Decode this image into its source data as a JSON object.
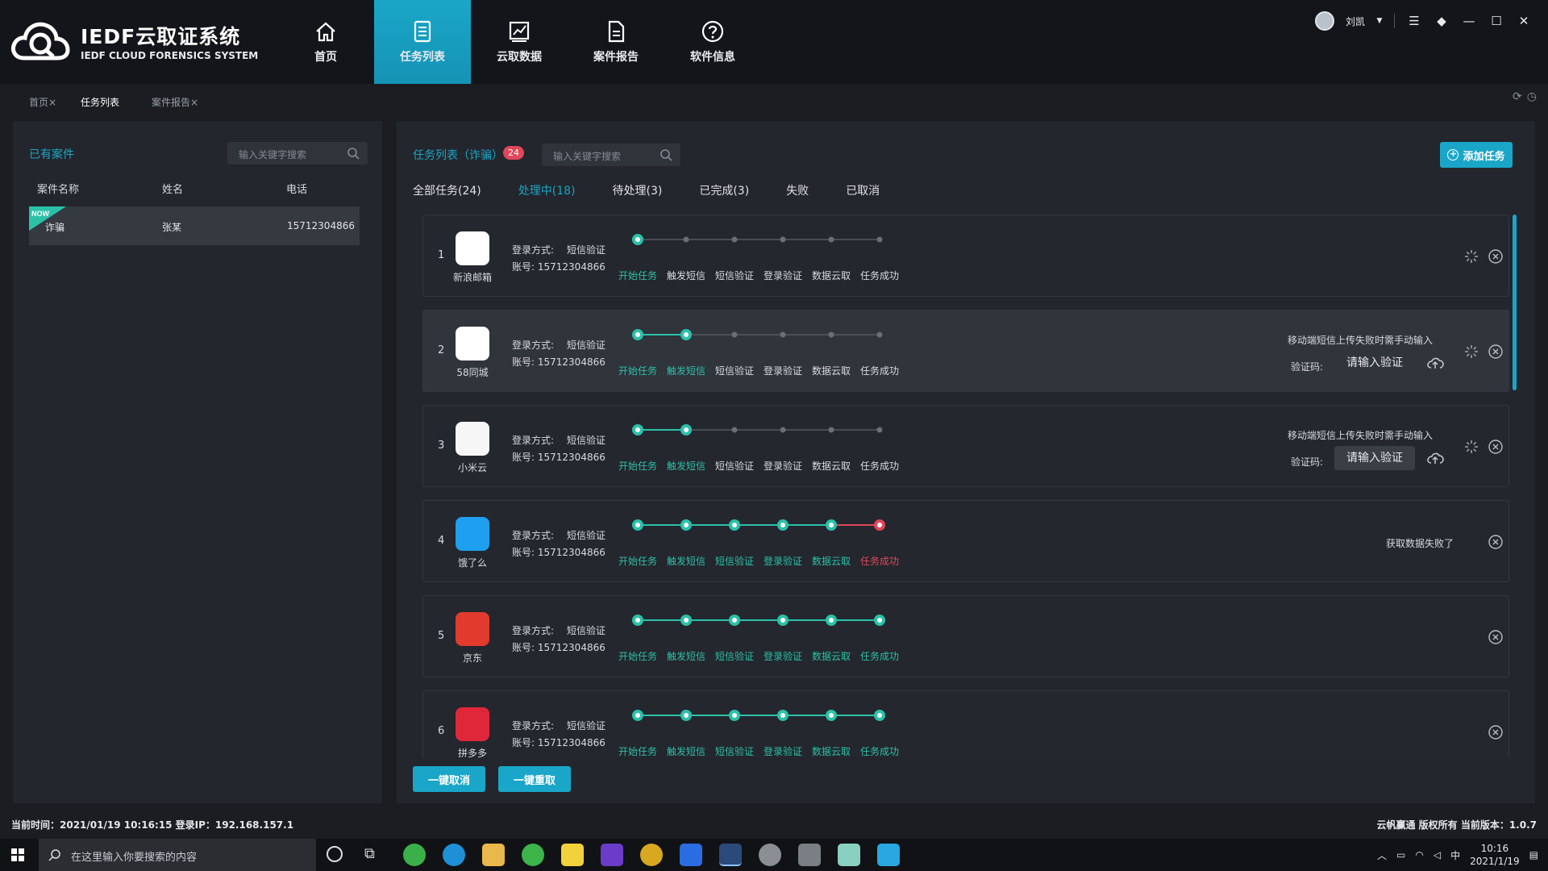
{
  "app": {
    "title": "IEDF云取证系统",
    "subtitle": "IEDF CLOUD FORENSICS SYSTEM"
  },
  "nav": {
    "items": [
      {
        "label": "首页",
        "icon": "home-icon"
      },
      {
        "label": "任务列表",
        "icon": "list-icon",
        "active": true
      },
      {
        "label": "云取数据",
        "icon": "chart-icon"
      },
      {
        "label": "案件报告",
        "icon": "document-icon"
      },
      {
        "label": "软件信息",
        "icon": "help-icon"
      }
    ]
  },
  "user": {
    "name": "刘凯"
  },
  "page_tabs": [
    {
      "label": "首页×"
    },
    {
      "label": "任务列表",
      "active": true
    },
    {
      "label": "案件报告×"
    }
  ],
  "cases": {
    "title": "已有案件",
    "search_placeholder": "输入关键字搜索",
    "columns": [
      "案件名称",
      "姓名",
      "电话"
    ],
    "rows": [
      {
        "badge": "NOW",
        "name": "诈骗",
        "person": "张某",
        "phone": "15712304866"
      }
    ]
  },
  "tasks": {
    "title": "任务列表（诈骗）",
    "count": "24",
    "search_placeholder": "输入关键字搜索",
    "add_label": "添加任务",
    "filters": [
      "全部任务(24)",
      "处理中(18)",
      "待处理(3)",
      "已完成(3)",
      "失败",
      "已取消"
    ],
    "active_filter": 1,
    "step_labels": [
      "开始任务",
      "触发短信",
      "短信验证",
      "登录验证",
      "数据云取",
      "任务成功"
    ],
    "login_label": "登录方式:",
    "login_value": "短信验证",
    "account_label": "账号:",
    "verify_label": "验证码:",
    "verify_placeholder": "请输入验证",
    "manual_note": "移动端短信上传失败时需手动输入",
    "items": [
      {
        "num": "1",
        "app": "新浪邮箱",
        "account": "15712304866",
        "progress": 1,
        "failed": false,
        "manual": false,
        "status": "",
        "color": "#ffffff"
      },
      {
        "num": "2",
        "app": "58同城",
        "account": "15712304866",
        "progress": 2,
        "failed": false,
        "manual": true,
        "status": "",
        "color": "#ffffff"
      },
      {
        "num": "3",
        "app": "小米云",
        "account": "15712304866",
        "progress": 2,
        "failed": false,
        "manual": true,
        "status": "",
        "color": "#f6f6f6"
      },
      {
        "num": "4",
        "app": "饿了么",
        "account": "15712304866",
        "progress": 6,
        "failed": true,
        "manual": false,
        "status": "获取数据失败了",
        "color": "#1e9ff0"
      },
      {
        "num": "5",
        "app": "京东",
        "account": "15712304866",
        "progress": 6,
        "failed": false,
        "manual": false,
        "status": "",
        "color": "#e33a2e"
      },
      {
        "num": "6",
        "app": "拼多多",
        "account": "15712304866",
        "progress": 6,
        "failed": false,
        "manual": false,
        "status": "",
        "color": "#e0273a"
      }
    ],
    "cancel_all": "一键取消",
    "retry_all": "一键重取"
  },
  "status": {
    "left": "当前时间：2021/01/19 10:16:15   登录IP：192.168.157.1",
    "right": "云帆赢通 版权所有 当前版本：1.0.7"
  },
  "taskbar": {
    "search_placeholder": "在这里输入你要搜索的内容",
    "time": "10:16",
    "date": "2021/1/19",
    "ime": "中"
  },
  "colors": {
    "accent": "#1aa6c8",
    "success": "#2bc1a9",
    "danger": "#e0475a"
  }
}
